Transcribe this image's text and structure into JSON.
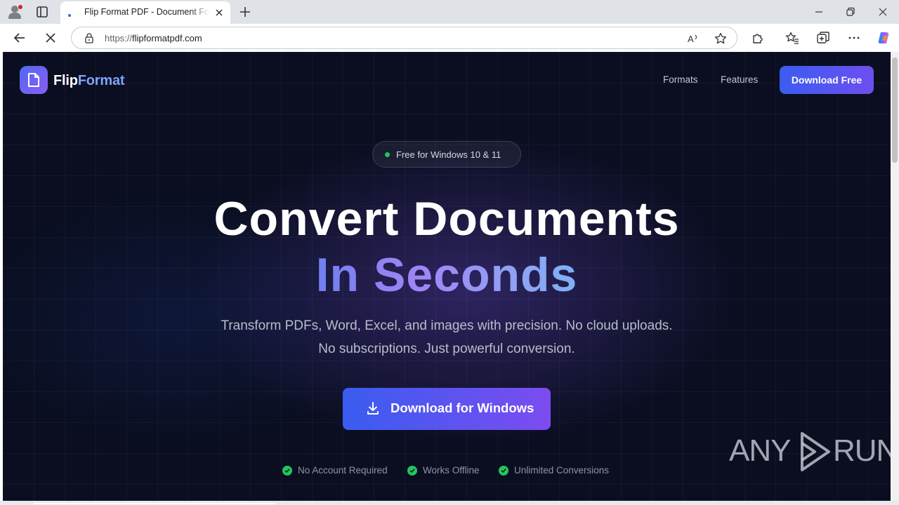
{
  "browser": {
    "tab_title": "Flip Format PDF - Document Format Converter",
    "url_scheme": "https://",
    "url_host": "flipformatpdf.com"
  },
  "site": {
    "logo_primary": "Flip",
    "logo_accent": "Format",
    "nav": [
      "Formats",
      "Features"
    ],
    "nav_cta": "Download Free"
  },
  "hero": {
    "badge": "Free for Windows 10 & 11",
    "title_line1": "Convert Documents",
    "title_line2": "In Seconds",
    "subtitle_line1": "Transform PDFs, Word, Excel, and images with precision. No cloud uploads.",
    "subtitle_line2": "No subscriptions. Just powerful conversion.",
    "cta_label": "Download for Windows",
    "features": [
      "No Account Required",
      "Works Offline",
      "Unlimited Conversions"
    ]
  },
  "watermark": {
    "left": "ANY",
    "right": "RUN"
  },
  "colors": {
    "page_bg": "#0a0e20",
    "accent_blue": "#3b5cf0",
    "accent_purple": "#7c4cf0",
    "check_green": "#22c55e"
  },
  "icons": [
    "profile-icon",
    "tab-actions-icon",
    "loading-icon",
    "close-icon",
    "plus-icon",
    "minimize-icon",
    "restore-icon",
    "back-icon",
    "stop-icon",
    "lock-icon",
    "read-aloud-icon",
    "star-icon",
    "extensions-icon",
    "favorites-icon",
    "collections-icon",
    "more-icon",
    "copilot-icon",
    "document-icon",
    "download-icon",
    "check-icon"
  ]
}
